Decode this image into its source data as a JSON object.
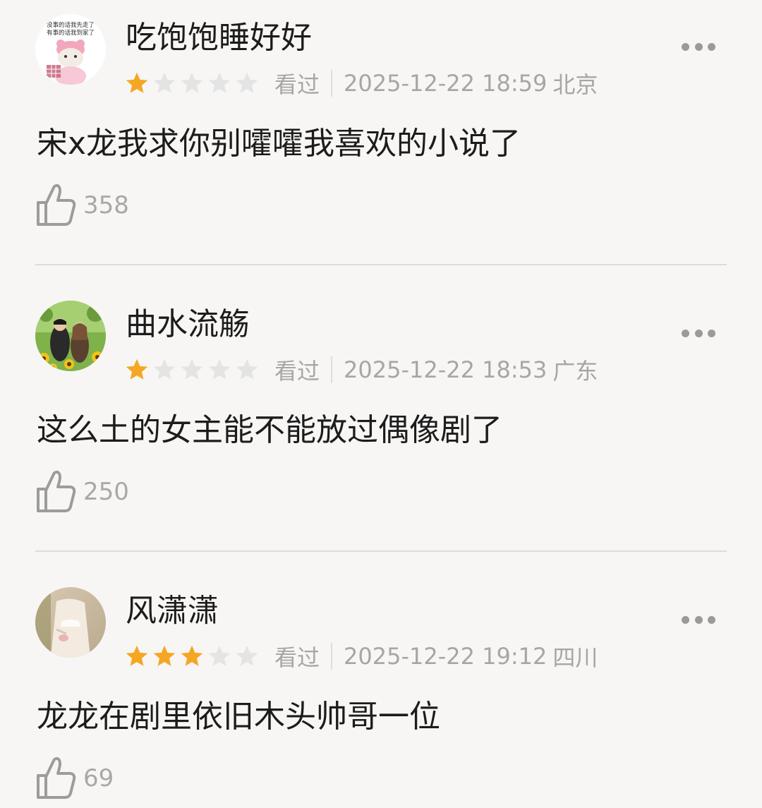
{
  "reviews": [
    {
      "username": "吃饱饱睡好好",
      "avatar_text": [
        "没事的话我先走了",
        "有事的话我到家了"
      ],
      "rating": 1,
      "status": "看过",
      "datetime": "2025-12-22 18:59",
      "location": "北京",
      "content": "宋x龙我求你别嚯嚯我喜欢的小说了",
      "likes": "358"
    },
    {
      "username": "曲水流觞",
      "rating": 1,
      "status": "看过",
      "datetime": "2025-12-22 18:53",
      "location": "广东",
      "content": "这么土的女主能不能放过偶像剧了",
      "likes": "250"
    },
    {
      "username": "风潇潇",
      "rating": 3,
      "status": "看过",
      "datetime": "2025-12-22 19:12",
      "location": "四川",
      "content": "龙龙在剧里依旧木头帅哥一位",
      "likes": "69"
    }
  ],
  "colors": {
    "star_filled": "#f5a623",
    "star_empty": "#e4e4e4",
    "meta_text": "#a6a6a6"
  },
  "icons": {
    "more": "more-dots-icon",
    "like": "thumbs-up-icon",
    "star": "star-icon"
  }
}
